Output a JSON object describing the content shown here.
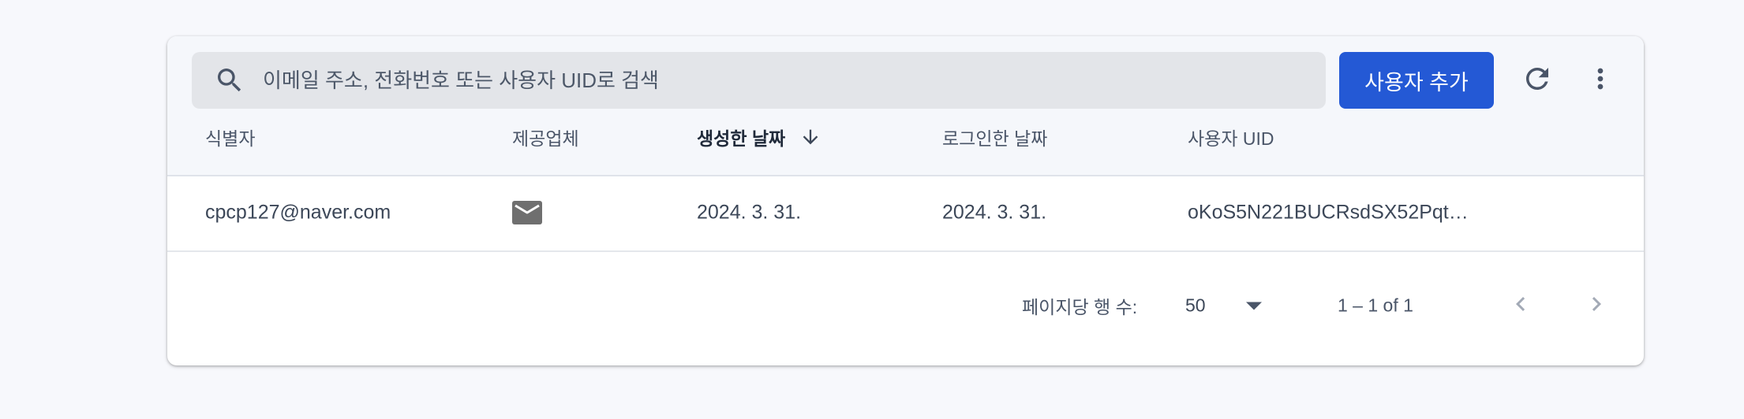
{
  "search": {
    "placeholder": "이메일 주소, 전화번호 또는 사용자 UID로 검색",
    "icon": "search-icon"
  },
  "toolbar": {
    "add_user_label": "사용자 추가",
    "refresh_icon": "refresh-icon",
    "more_icon": "more-vert-icon",
    "accent_color": "#2459d5"
  },
  "table": {
    "columns": [
      {
        "label": "식별자"
      },
      {
        "label": "제공업체"
      },
      {
        "label": "생성한 날짜",
        "sorted": "descending"
      },
      {
        "label": "로그인한 날짜"
      },
      {
        "label": "사용자 UID"
      }
    ],
    "rows": [
      {
        "identifier": "cpcp127@naver.com",
        "provider_icon": "email-icon",
        "created": "2024. 3. 31.",
        "signed_in": "2024. 3. 31.",
        "uid": "oKoS5N221BUCRsdSX52PqtX…"
      }
    ]
  },
  "pagination": {
    "rows_per_page_label": "페이지당 행 수:",
    "rows_per_page_value": "50",
    "range": "1 – 1 of 1"
  }
}
